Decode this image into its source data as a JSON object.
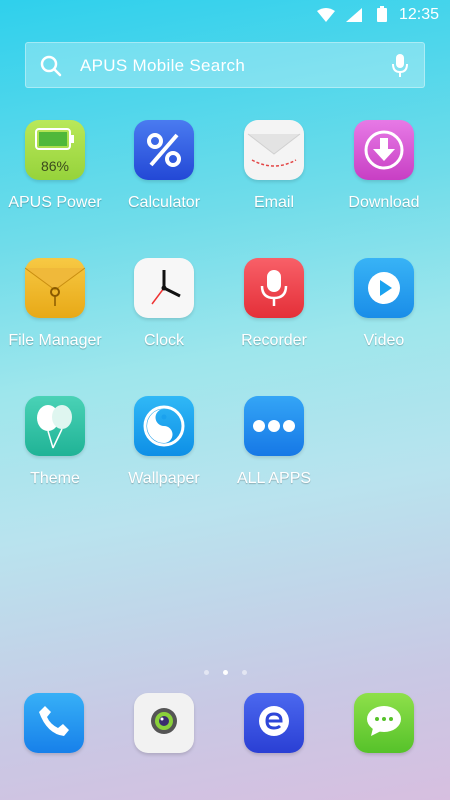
{
  "status_bar": {
    "time": "12:35"
  },
  "search": {
    "placeholder": "APUS Mobile Search"
  },
  "apps": [
    {
      "label": "APUS Power",
      "icon": "battery-power-icon",
      "percent": "86%"
    },
    {
      "label": "Calculator",
      "icon": "percent-calculator-icon"
    },
    {
      "label": "Email",
      "icon": "envelope-icon"
    },
    {
      "label": "Download",
      "icon": "download-arrow-icon"
    },
    {
      "label": "File Manager",
      "icon": "folder-envelope-icon"
    },
    {
      "label": "Clock",
      "icon": "clock-icon"
    },
    {
      "label": "Recorder",
      "icon": "microphone-icon"
    },
    {
      "label": "Video",
      "icon": "play-icon"
    },
    {
      "label": "Theme",
      "icon": "balloons-icon"
    },
    {
      "label": "Wallpaper",
      "icon": "yin-yang-icon"
    },
    {
      "label": "ALL APPS",
      "icon": "three-dots-icon"
    }
  ],
  "dock": [
    {
      "icon": "phone-icon"
    },
    {
      "icon": "camera-icon"
    },
    {
      "icon": "browser-e-icon"
    },
    {
      "icon": "message-bubble-icon"
    }
  ],
  "colors": {
    "power": "#a6dd4b",
    "calculator": "#2f5fe0",
    "email": "#f3f3f3",
    "download": "#d957d6",
    "file_manager": "#f2b82c",
    "clock": "#f7f7f7",
    "recorder": "#f2444b",
    "video": "#1d9ff0",
    "theme": "#33c6a8",
    "wallpaper": "#1aa1ee",
    "all_apps": "#1c8ff2"
  },
  "page_indicator": {
    "pages": 3,
    "active": 1
  }
}
